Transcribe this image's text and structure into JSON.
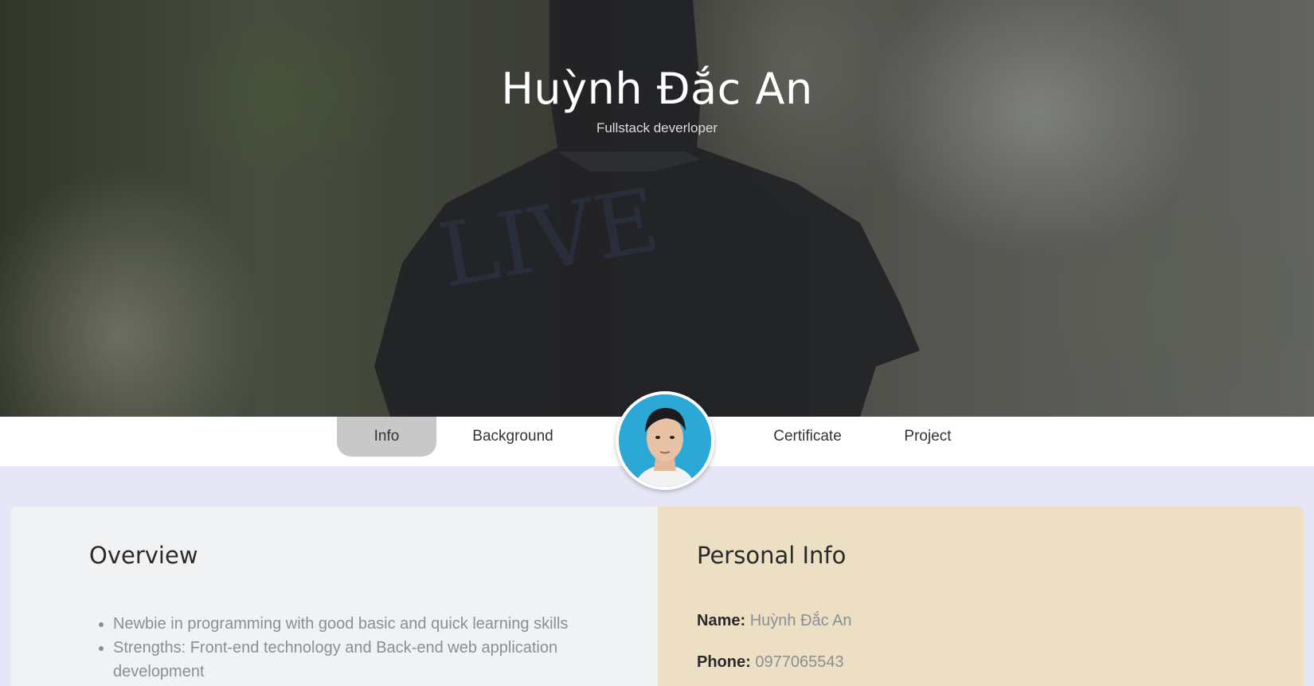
{
  "header": {
    "name": "Huỳnh Đắc An",
    "title": "Fullstack deverloper"
  },
  "nav": {
    "items": [
      {
        "label": "Info",
        "active": true
      },
      {
        "label": "Background",
        "active": false
      },
      {
        "label": "Certificate",
        "active": false
      },
      {
        "label": "Project",
        "active": false
      }
    ]
  },
  "overview": {
    "heading": "Overview",
    "points": [
      "Newbie in programming with good basic and quick learning skills",
      "Strengths: Front-end technology and Back-end web application development"
    ]
  },
  "personal_info": {
    "heading": "Personal Info",
    "name_label": "Name:",
    "name_value": "Huỳnh Đắc An",
    "phone_label": "Phone:",
    "phone_value": "0977065543"
  },
  "colors": {
    "page_background": "#e6e6f7",
    "active_tab": "#c8c8c8",
    "overview_panel": "#f1f2f4",
    "personal_panel": "#ecdfc4",
    "avatar_background": "#2ba8d6"
  }
}
